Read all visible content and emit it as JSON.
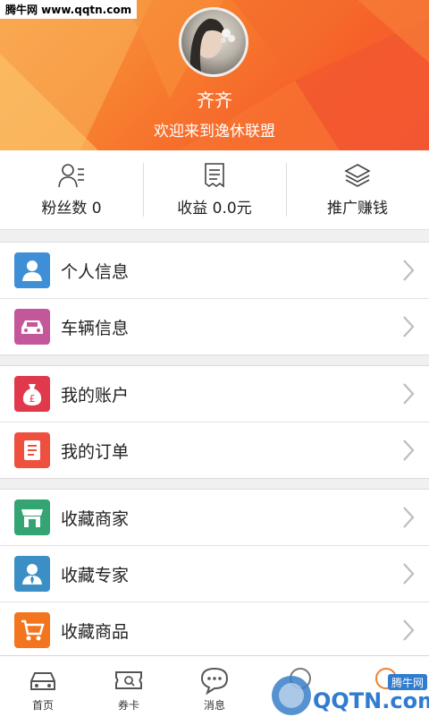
{
  "watermark": "腾牛网 www.qqtn.com",
  "profile": {
    "name": "齐齐",
    "welcome": "欢迎来到逸休联盟"
  },
  "stats": [
    {
      "label": "粉丝数 0",
      "icon": "user-list-icon"
    },
    {
      "label": "收益 0.0元",
      "icon": "receipt-icon"
    },
    {
      "label": "推广赚钱",
      "icon": "layers-icon"
    }
  ],
  "menu": {
    "group1": [
      {
        "label": "个人信息",
        "icon": "person-icon",
        "color": "#3e8fd6"
      },
      {
        "label": "车辆信息",
        "icon": "car-icon",
        "color": "#c4579a"
      }
    ],
    "group2": [
      {
        "label": "我的账户",
        "icon": "money-bag-icon",
        "color": "#e0394b"
      },
      {
        "label": "我的订单",
        "icon": "order-icon",
        "color": "#ef4f3f"
      }
    ],
    "group3": [
      {
        "label": "收藏商家",
        "icon": "store-icon",
        "color": "#34a472"
      },
      {
        "label": "收藏专家",
        "icon": "expert-icon",
        "color": "#3b8fc4"
      },
      {
        "label": "收藏商品",
        "icon": "cart-icon",
        "color": "#f3751d"
      }
    ]
  },
  "tabs": [
    {
      "label": "首页",
      "icon": "car-tab-icon"
    },
    {
      "label": "券卡",
      "icon": "ticket-icon"
    },
    {
      "label": "消息",
      "icon": "message-icon"
    },
    {
      "label": "",
      "icon": "tab4-icon"
    },
    {
      "label": "",
      "icon": "tab5-icon"
    }
  ],
  "corner_logo": {
    "text": "QQTN.com",
    "subtext": "腾牛网"
  },
  "colors": {
    "header": "#f6702e",
    "background": "#f0f0f0"
  }
}
